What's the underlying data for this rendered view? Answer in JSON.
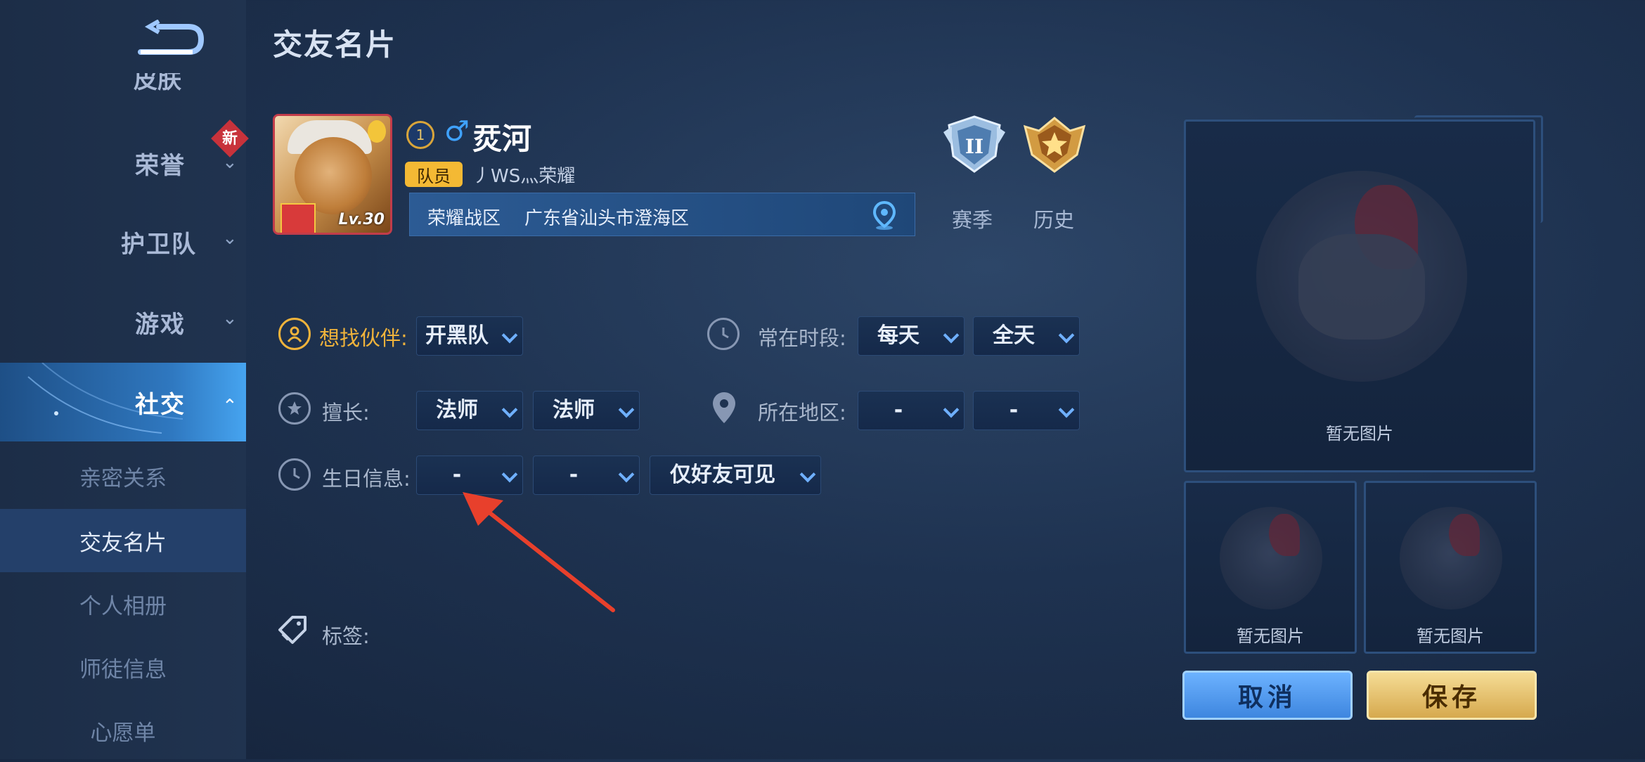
{
  "sidebar": {
    "partial_item": "皮肤",
    "items": [
      {
        "label": "荣誉",
        "badge": "新"
      },
      {
        "label": "护卫队"
      },
      {
        "label": "游戏"
      },
      {
        "label": "社交"
      }
    ],
    "sub_items": [
      "亲密关系",
      "交友名片",
      "个人相册",
      "师徒信息",
      "心愿单"
    ]
  },
  "header": {
    "title": "交友名片",
    "back_icon": "back-arrow-icon"
  },
  "profile": {
    "level_text": "Lv.30",
    "rank_badge": "1",
    "gender": "♂",
    "name": "烎河",
    "role": "队员",
    "team": "丿WS灬荣耀",
    "region_label": "荣耀战区",
    "region_value": "广东省汕头市澄海区"
  },
  "rank": {
    "season_label": "赛季",
    "season_tier": "II",
    "history_label": "历史"
  },
  "form": {
    "partner": {
      "label": "想找伙伴:",
      "value": "开黑队"
    },
    "active_time": {
      "label": "常在时段:",
      "day": "每天",
      "period": "全天"
    },
    "skill": {
      "label": "擅长:",
      "primary": "法师",
      "secondary": "法师"
    },
    "area": {
      "label": "所在地区:",
      "province": "-",
      "city": "-"
    },
    "birthday": {
      "label": "生日信息:",
      "month": "-",
      "day": "-",
      "visibility": "仅好友可见"
    },
    "tags": {
      "label": "标签:"
    }
  },
  "photos": {
    "empty_text": "暂无图片"
  },
  "actions": {
    "cancel": "取消",
    "save": "保存"
  },
  "colors": {
    "gold": "#f0b33b",
    "accent_blue": "#46a4f0",
    "annotation_red": "#e8402c"
  }
}
